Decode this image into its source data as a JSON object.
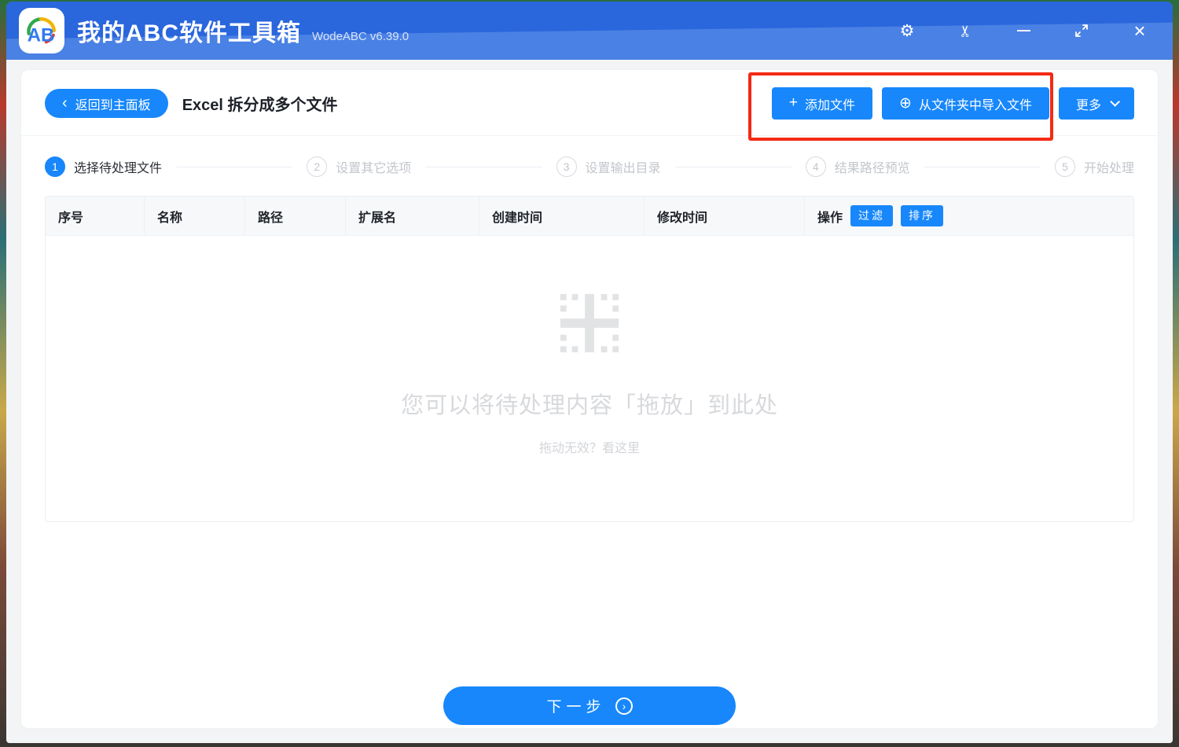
{
  "header": {
    "app_title": "我的ABC软件工具箱",
    "version": "WodeABC v6.39.0",
    "logo_text": "AB",
    "icons": {
      "settings": "⚙",
      "scissors": "✂",
      "close": "×",
      "back_chevron": "‹",
      "plus": "+",
      "circle_plus": "⊕",
      "next_arrow": "›"
    }
  },
  "toolbar": {
    "back_button": "返回到主面板",
    "page_title": "Excel 拆分成多个文件",
    "add_files_button": "添加文件",
    "import_folder_button": "从文件夹中导入文件",
    "more_button": "更多"
  },
  "steps": [
    {
      "number": "1",
      "label": "选择待处理文件"
    },
    {
      "number": "2",
      "label": "设置其它选项"
    },
    {
      "number": "3",
      "label": "设置输出目录"
    },
    {
      "number": "4",
      "label": "结果路径预览"
    },
    {
      "number": "5",
      "label": "开始处理"
    }
  ],
  "table": {
    "columns": [
      "序号",
      "名称",
      "路径",
      "扩展名",
      "创建时间",
      "修改时间",
      "操作"
    ],
    "filter_button": "过滤",
    "sort_button": "排序"
  },
  "dropzone": {
    "main_text": "您可以将待处理内容「拖放」到此处",
    "hint_text": "拖动无效？看这里"
  },
  "footer": {
    "next_button": "下一步"
  },
  "colors": {
    "accent": "#1787fb",
    "header_dark": "#2a66dc",
    "header_light": "#4a81e4",
    "annotation": "#f42a14"
  }
}
